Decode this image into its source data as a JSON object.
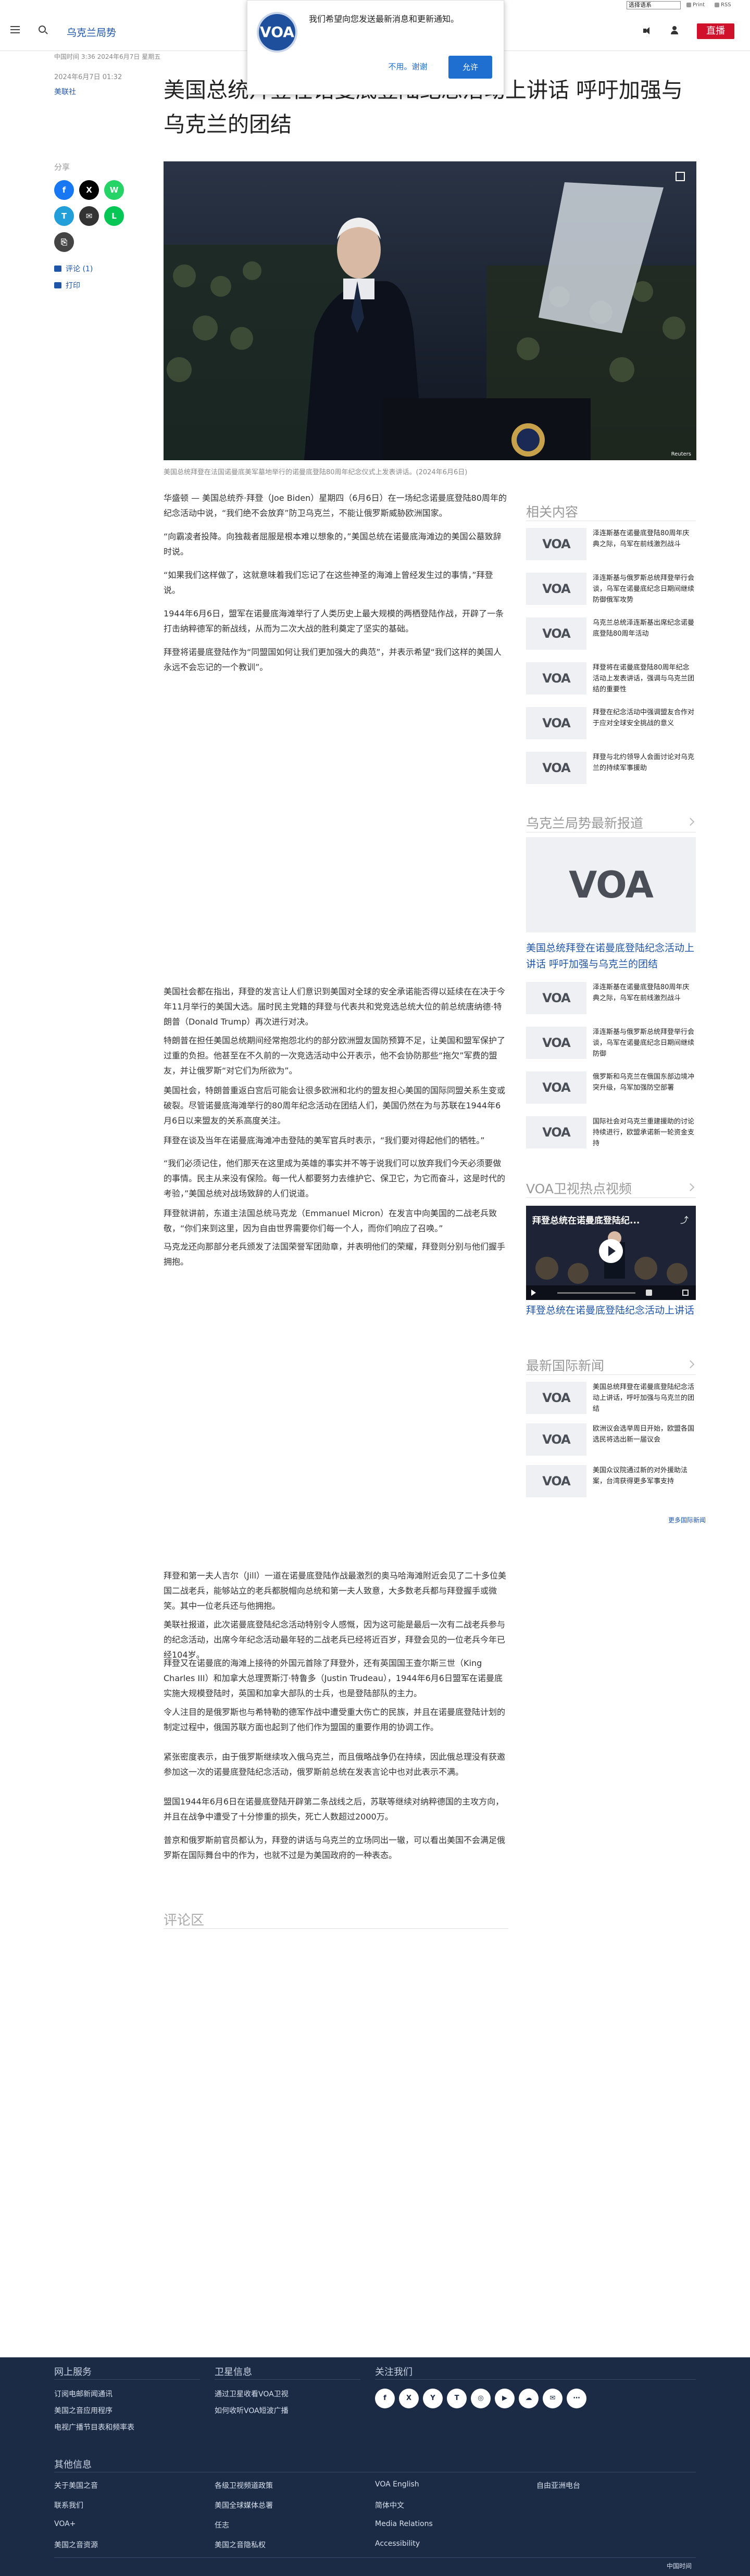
{
  "utility": {
    "language_select": "选择语系",
    "link_1": "Print",
    "link_2": "RSS"
  },
  "header": {
    "section": "乌克兰局势",
    "live_label": "直播"
  },
  "notification": {
    "logo": "VOA",
    "message": "我们希望向您发送最新消息和更新通知。",
    "later": "不用。谢谢",
    "allow": "允许"
  },
  "article": {
    "meta_top": "中国时间 3:36 2024年6月7日 星期五",
    "date": "2024年6月7日 01:32",
    "byline": "美联社",
    "title": "美国总统拜登在诺曼底登陆纪念活动上讲话 呼吁加强与乌克兰的团结",
    "caption": "美国总统拜登在法国诺曼底美军墓地举行的诺曼底登陆80周年纪念仪式上发表讲话。(2024年6月6日)",
    "photo_credit": "Reuters",
    "paragraphs": [
      "华盛顿 — 美国总统乔·拜登（Joe Biden）星期四（6月6日）在一场纪念诺曼底登陆80周年的纪念活动中说，“我们绝不会放弃”防卫乌克兰，不能让俄罗斯威胁欧洲国家。",
      "“向霸凌者投降。向独裁者屈服是根本难以想象的，”美国总统在诺曼底海滩边的美国公墓致辞时说。",
      "“如果我们这样做了，这就意味着我们忘记了在这些神圣的海滩上曾经发生过的事情，”拜登说。",
      "1944年6月6日，盟军在诺曼底海滩举行了人类历史上最大规模的两栖登陆作战，开辟了一条打击纳粹德军的新战线，从而为二次大战的胜利奠定了坚实的基础。",
      "拜登将诺曼底登陆作为“同盟国如何让我们更加强大的典范”，并表示希望“我们这样的美国人永远不会忘记的一个教训”。",
      "美国社会都在指出，拜登的发言让人们意识到美国对全球的安全承诺能否得以延续在在决于今年11月举行的美国大选。届时民主党籍的拜登与代表共和党竞选总统大位的前总统唐纳德·特朗普（Donald Trump）再次进行对决。",
      "特朗普在担任美国总统期间经常抱怨北约的部分欧洲盟友国防预算不足，让美国和盟军保护了过重的负担。他甚至在不久前的一次竞选活动中公开表示，他不会协防那些“拖欠”军费的盟友，并让俄罗斯“对它们为所欲为”。",
      "美国社会，特朗普重返白宫后可能会让很多欧洲和北约的盟友担心美国的国际同盟关系生变或破裂。尽管诺曼底海滩举行的80周年纪念活动在团结人们，美国仍然在为与苏联在1944年6月6日以来盟友的关系高度关注。",
      "拜登在谈及当年在诺曼底海滩冲击登陆的美军官兵时表示，“我们要对得起他们的牺牲。”",
      "“我们必须记住，他们那天在这里成为英雄的事实并不等于说我们可以放弃我们今天必须要做的事情。民主从来没有保险。每一代人都要努力去维护它、保卫它，为它而奋斗，这是时代的考验，”美国总统对战场致辞的人们说道。",
      "拜登就讲前，东道主法国总统马克龙（Emmanuel Micron）在发言中向美国的二战老兵致敬，“你们来到这里，因为自由世界需要你们每一个人，而你们响应了召唤。”",
      "马克龙还向那部分老兵颁发了法国荣誉军团勋章，并表明他们的荣耀，拜登则分别与他们握手拥抱。",
      "拜登和第一夫人吉尔（Jill）一道在诺曼底登陆作战最激烈的奥马哈海滩附近会见了二十多位美国二战老兵，能够站立的老兵都脱帽向总统和第一夫人致意，大多数老兵都与拜登握手或微笑。其中一位老兵还与他拥抱。",
      "美联社报道，此次诺曼底登陆纪念活动特别令人感慨，因为这可能是最后一次有二战老兵参与的纪念活动，出席今年纪念活动最年轻的二战老兵已经将近百岁，拜登会见的一位老兵今年已经104岁。",
      "拜登又在诺曼底的海滩上接待的外国元首除了拜登外，还有英国国王查尔斯三世（King Charles III）和加拿大总理贾斯汀·特鲁多（Justin Trudeau），1944年6月6日盟军在诺曼底实施大规模登陆时，英国和加拿大部队的士兵，也是登陆部队的主力。",
      "令人注目的是俄罗斯也与希特勒的德军作战中遭受重大伤亡的民族，并且在诺曼底登陆计划的制定过程中，俄国苏联方面也起到了他们作为盟国的重要作用的协调工作。",
      "紧张密度表示，由于俄罗斯继续攻入俄乌克兰，而且俄略战争仍在持续，因此俄总理没有获邀参加这一次的诺曼底登陆纪念活动，俄罗斯前总统在发表言论中也对此表示不满。",
      "盟国1944年6月6日在诺曼底登陆开辟第二条战线之后，苏联等继续对纳粹德国的主攻方向，并且在战争中遭受了十分惨重的损失，死亡人数超过2000万。",
      "普京和俄罗斯前官员都认为，拜登的讲话与乌克兰的立场同出一辙，可以看出美国不会满足俄罗斯在国际舞台中的作为，也就不过是为美国政府的一种表态。"
    ]
  },
  "share": {
    "label": "分享",
    "buttons": [
      {
        "label": "f",
        "color": "#1877f2"
      },
      {
        "label": "X",
        "color": "#000000"
      },
      {
        "label": "W",
        "color": "#25d366"
      },
      {
        "label": "T",
        "color": "#229ed9"
      },
      {
        "label": "✉",
        "color": "#333333"
      },
      {
        "label": "L",
        "color": "#06c755"
      },
      {
        "label": "⎘",
        "color": "#444444"
      }
    ],
    "comments": "评论 (1)",
    "print": "打印"
  },
  "sidebar": {
    "related_heading": "相关内容",
    "related": [
      "泽连斯基在诺曼底登陆80周年庆典之际，乌军在前线激烈战斗",
      "泽连斯基与俄罗斯总统拜登举行会谈，乌军在诺曼底纪念日期间继续防御俄军攻势",
      "乌克兰总统泽连斯基出席纪念诺曼底登陆80周年活动",
      "拜登将在诺曼底登陆80周年纪念活动上发表讲话，强调与乌克兰团结的重要性",
      "拜登在纪念活动中强调盟友合作对于应对全球安全挑战的意义",
      "拜登与北约领导人会面讨论对乌克兰的持续军事援助"
    ],
    "latest_heading": "乌克兰局势最新报道",
    "feature_title": "美国总统拜登在诺曼底登陆纪念活动上讲话 呼吁加强与乌克兰的团结",
    "latest": [
      "泽连斯基在诺曼底登陆80周年庆典之际，乌军在前线激烈战斗",
      "泽连斯基与俄罗斯总统拜登举行会谈，乌军在诺曼底纪念日期间继续防御",
      "俄罗斯和乌克兰在俄国东部边境冲突升级，乌军加强防空部署",
      "国际社会对乌克兰重建援助的讨论持续进行，欧盟承诺新一轮资金支持"
    ],
    "video_heading": "VOA卫视热点视频",
    "video_title": "拜登总统在诺曼底登陆纪念活动上讲话",
    "video_overlay": "拜登总统在诺曼底登陆纪...",
    "news_heading": "最新国际新闻",
    "news": [
      "美国总统拜登在诺曼底登陆纪念活动上讲话，呼吁加强与乌克兰的团结",
      "欧洲议会选举周日开始，欧盟各国选民将选出新一届议会",
      "美国众议院通过新的对外援助法案，台湾获得更多军事支持"
    ],
    "more": "更多国际新闻"
  },
  "comments": {
    "heading": "评论区"
  },
  "footer": {
    "col1_heading": "网上服务",
    "col1_links": [
      "订阅电邮新闻通讯",
      "美国之音应用程序",
      "电视广播节目表和频率表"
    ],
    "col2_heading": "卫星信息",
    "col2_links": [
      "通过卫星收看VOA卫视",
      "如何收听VOA短波广播"
    ],
    "col3_heading": "关注我们",
    "social": [
      "f",
      "X",
      "Y",
      "T",
      "◎",
      "▶",
      "☁",
      "✉",
      "⋯"
    ],
    "other_heading": "其他信息",
    "other_links": [
      "关于美国之音",
      "各级卫视频道政策",
      "VOA English",
      "自由亚洲电台",
      "联系我们",
      "美国全球媒体总署",
      "简体中文",
      "VOA+",
      "任志",
      "Media Relations",
      "美国之音资源",
      "美国之音隐私权",
      "Accessibility"
    ],
    "bottom_link": "中国时间"
  }
}
